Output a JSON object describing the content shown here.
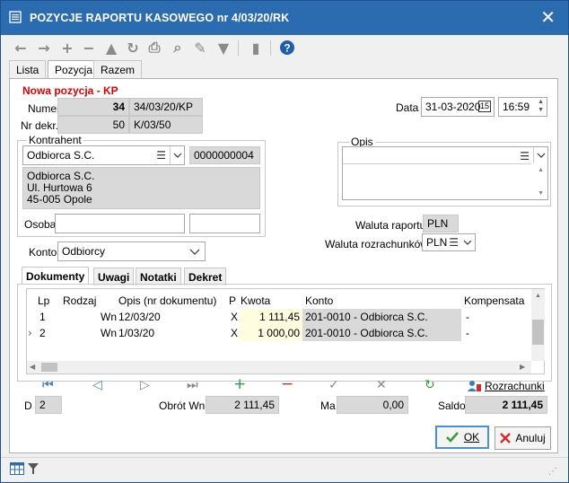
{
  "window": {
    "title": "POZYCJE RAPORTU KASOWEGO nr 4/03/20/RK"
  },
  "toolbar": {
    "icons": [
      "arrow-left-icon",
      "arrow-right-icon",
      "plus-icon",
      "minus-icon",
      "triangle-icon",
      "refresh-icon",
      "print-icon",
      "zoom-icon",
      "filter-icon",
      "book-icon",
      "help-icon"
    ]
  },
  "tabs": [
    "Lista",
    "Pozycja",
    "Razem"
  ],
  "form": {
    "heading": "Nowa pozycja - KP",
    "numer_label": "Numer",
    "numer_value": "34",
    "numer_full": "34/03/20/KP",
    "nrdekr_label": "Nr dekr.",
    "nrdekr_value": "50",
    "nrdekr_full": "K/03/50",
    "data_label": "Data",
    "date_value": "31-03-2020",
    "date_icon": "15",
    "time_value": "16:59"
  },
  "kontrahent": {
    "title": "Kontrahent",
    "name": "Odbiorca S.C.",
    "code": "0000000004",
    "address": [
      "Odbiorca S.C.",
      "Ul. Hurtowa 6",
      "45-005 Opole"
    ],
    "osoba_label": "Osoba"
  },
  "opis": {
    "title": "Opis"
  },
  "waluta": {
    "raportu_label": "Waluta raportu",
    "raportu_value": "PLN",
    "rozrachunkow_label": "Waluta rozrachunków",
    "rozrachunkow_value": "PLN"
  },
  "konto": {
    "label": "Konto",
    "value": "Odbiorcy"
  },
  "subtabs": [
    "Dokumenty",
    "Uwagi",
    "Notatki",
    "Dekret"
  ],
  "grid": {
    "headers": [
      "Lp",
      "Rodzaj",
      "Opis (nr dokumentu)",
      "P",
      "Kwota",
      "Konto",
      "Kompensata"
    ],
    "rows": [
      {
        "lp": "1",
        "rodzaj": "Wn",
        "opis": "12/03/20",
        "p": "X",
        "kwota": "1 111,45",
        "konto": "201-0010 - Odbiorca S.C.",
        "kompensata": "-"
      },
      {
        "lp": "2",
        "rodzaj": "Wn",
        "opis": "1/03/20",
        "p": "X",
        "kwota": "1 000,00",
        "konto": "201-0010 - Odbiorca S.C.",
        "kompensata": "-"
      }
    ]
  },
  "nav": {
    "rozrachunki": "Rozrachunki"
  },
  "footer": {
    "d_label": "D",
    "d_value": "2",
    "obrot_label": "Obrót Wn",
    "obrot_value": "2 111,45",
    "ma_label": "Ma",
    "ma_value": "0,00",
    "saldo_label": "Saldo",
    "saldo_value": "2 111,45"
  },
  "buttons": {
    "ok": "OK",
    "anuluj": "Anuluj"
  },
  "colors": {
    "title_bar": "#2b6cb0",
    "heading_red": "#e00000",
    "highlight_yellow": "#fffde0",
    "ok_green": "#3a9d3a",
    "cancel_red": "#d22b2b"
  }
}
